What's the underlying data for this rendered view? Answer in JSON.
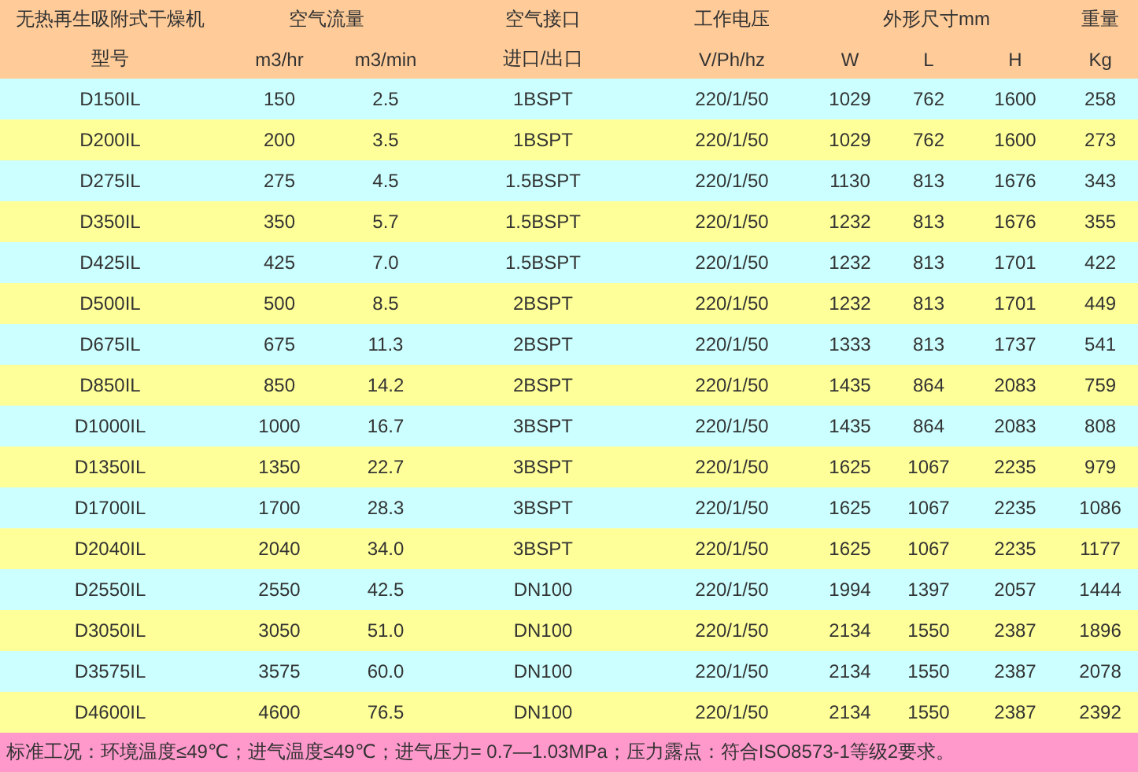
{
  "table": {
    "header_groups": [
      {
        "label": "无热再生吸附式干燥机",
        "columns": [
          "型号"
        ]
      },
      {
        "label": "空气流量",
        "columns": [
          "m3/hr",
          "m3/min"
        ]
      },
      {
        "label": "空气接口",
        "columns": [
          "进口/出口"
        ]
      },
      {
        "label": "工作电压",
        "columns": [
          "V/Ph/hz"
        ]
      },
      {
        "label": "外形尺寸mm",
        "columns": [
          "W",
          "L",
          "H"
        ]
      },
      {
        "label": "重量",
        "columns": [
          "Kg"
        ]
      }
    ],
    "rows": [
      [
        "D150IL",
        "150",
        "2.5",
        "1BSPT",
        "220/1/50",
        "1029",
        "762",
        "1600",
        "258"
      ],
      [
        "D200IL",
        "200",
        "3.5",
        "1BSPT",
        "220/1/50",
        "1029",
        "762",
        "1600",
        "273"
      ],
      [
        "D275IL",
        "275",
        "4.5",
        "1.5BSPT",
        "220/1/50",
        "1130",
        "813",
        "1676",
        "343"
      ],
      [
        "D350IL",
        "350",
        "5.7",
        "1.5BSPT",
        "220/1/50",
        "1232",
        "813",
        "1676",
        "355"
      ],
      [
        "D425IL",
        "425",
        "7.0",
        "1.5BSPT",
        "220/1/50",
        "1232",
        "813",
        "1701",
        "422"
      ],
      [
        "D500IL",
        "500",
        "8.5",
        "2BSPT",
        "220/1/50",
        "1232",
        "813",
        "1701",
        "449"
      ],
      [
        "D675IL",
        "675",
        "11.3",
        "2BSPT",
        "220/1/50",
        "1333",
        "813",
        "1737",
        "541"
      ],
      [
        "D850IL",
        "850",
        "14.2",
        "2BSPT",
        "220/1/50",
        "1435",
        "864",
        "2083",
        "759"
      ],
      [
        "D1000IL",
        "1000",
        "16.7",
        "3BSPT",
        "220/1/50",
        "1435",
        "864",
        "2083",
        "808"
      ],
      [
        "D1350IL",
        "1350",
        "22.7",
        "3BSPT",
        "220/1/50",
        "1625",
        "1067",
        "2235",
        "979"
      ],
      [
        "D1700IL",
        "1700",
        "28.3",
        "3BSPT",
        "220/1/50",
        "1625",
        "1067",
        "2235",
        "1086"
      ],
      [
        "D2040IL",
        "2040",
        "34.0",
        "3BSPT",
        "220/1/50",
        "1625",
        "1067",
        "2235",
        "1177"
      ],
      [
        "D2550IL",
        "2550",
        "42.5",
        "DN100",
        "220/1/50",
        "1994",
        "1397",
        "2057",
        "1444"
      ],
      [
        "D3050IL",
        "3050",
        "51.0",
        "DN100",
        "220/1/50",
        "2134",
        "1550",
        "2387",
        "1896"
      ],
      [
        "D3575IL",
        "3575",
        "60.0",
        "DN100",
        "220/1/50",
        "2134",
        "1550",
        "2387",
        "2078"
      ],
      [
        "D4600IL",
        "4600",
        "76.5",
        "DN100",
        "220/1/50",
        "2134",
        "1550",
        "2387",
        "2392"
      ]
    ]
  },
  "footer_note": "标准工况：环境温度≤49℃；进气温度≤49℃；进气压力= 0.7—1.03MPa；压力露点：符合ISO8573-1等级2要求。"
}
